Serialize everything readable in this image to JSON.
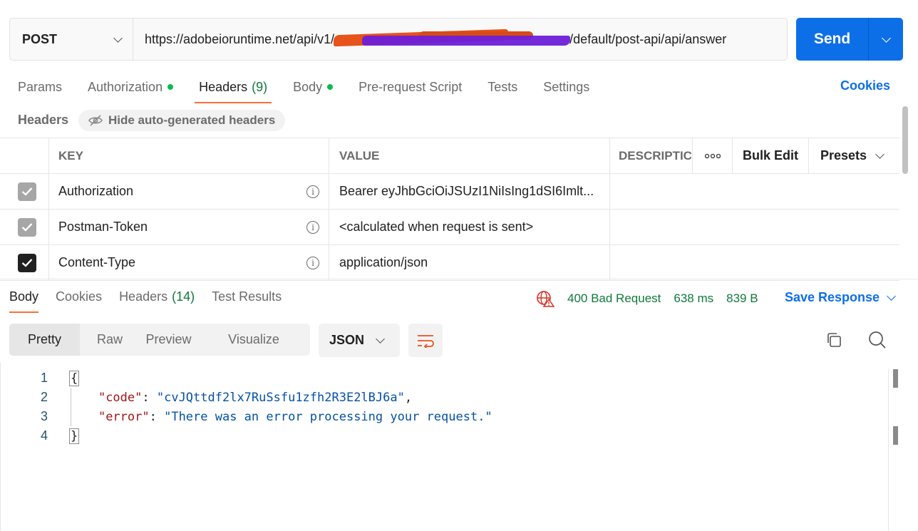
{
  "request": {
    "method": "POST",
    "url_prefix": "https://adobeioruntime.net/api/v1/",
    "url_suffix": "/default/post-api/api/answer",
    "send_label": "Send"
  },
  "request_tabs": [
    {
      "label": "Params",
      "count": "",
      "dot": false,
      "active": false
    },
    {
      "label": "Authorization",
      "count": "",
      "dot": true,
      "active": false
    },
    {
      "label": "Headers",
      "count": "(9)",
      "dot": false,
      "active": true
    },
    {
      "label": "Body",
      "count": "",
      "dot": true,
      "active": false
    },
    {
      "label": "Pre-request Script",
      "count": "",
      "dot": false,
      "active": false
    },
    {
      "label": "Tests",
      "count": "",
      "dot": false,
      "active": false
    },
    {
      "label": "Settings",
      "count": "",
      "dot": false,
      "active": false
    }
  ],
  "cookies_label": "Cookies",
  "headers_section": {
    "title": "Headers",
    "hide_auto_label": "Hide auto-generated headers"
  },
  "table": {
    "columns": {
      "key": "KEY",
      "value": "VALUE",
      "description": "DESCRIPTIC"
    },
    "bulk_edit": "Bulk Edit",
    "presets": "Presets",
    "rows": [
      {
        "checked": "grey",
        "key": "Authorization",
        "value": "Bearer eyJhbGciOiJSUzI1NiIsIng1dSI6Imlt..."
      },
      {
        "checked": "grey",
        "key": "Postman-Token",
        "value": "<calculated when request is sent>"
      },
      {
        "checked": "dark",
        "key": "Content-Type",
        "value": "application/json"
      }
    ]
  },
  "response_tabs": [
    {
      "label": "Body",
      "count": "",
      "active": true
    },
    {
      "label": "Cookies",
      "count": "",
      "active": false
    },
    {
      "label": "Headers",
      "count": "(14)",
      "active": false
    },
    {
      "label": "Test Results",
      "count": "",
      "active": false
    }
  ],
  "response_status": {
    "status": "400 Bad Request",
    "time": "638 ms",
    "size": "839 B",
    "save_label": "Save Response",
    "status_color": "#0f7a3a"
  },
  "format_tabs": [
    "Pretty",
    "Raw",
    "Preview",
    "Visualize"
  ],
  "format_active": "Pretty",
  "language": "JSON",
  "code": {
    "line_numbers": [
      "1",
      "2",
      "3",
      "4"
    ],
    "open_brace": "{",
    "close_brace": "}",
    "code_key": "\"code\"",
    "code_value": "\"cvJQttdf2lx7RuSsfu1zfh2R3E2lBJ6a\"",
    "error_key": "\"error\"",
    "error_value": "\"There was an error processing your request.\""
  },
  "colors": {
    "accent": "#0d6fe8",
    "active_tab_underline": "#ff6c37",
    "green_dot": "#0cbb52"
  }
}
